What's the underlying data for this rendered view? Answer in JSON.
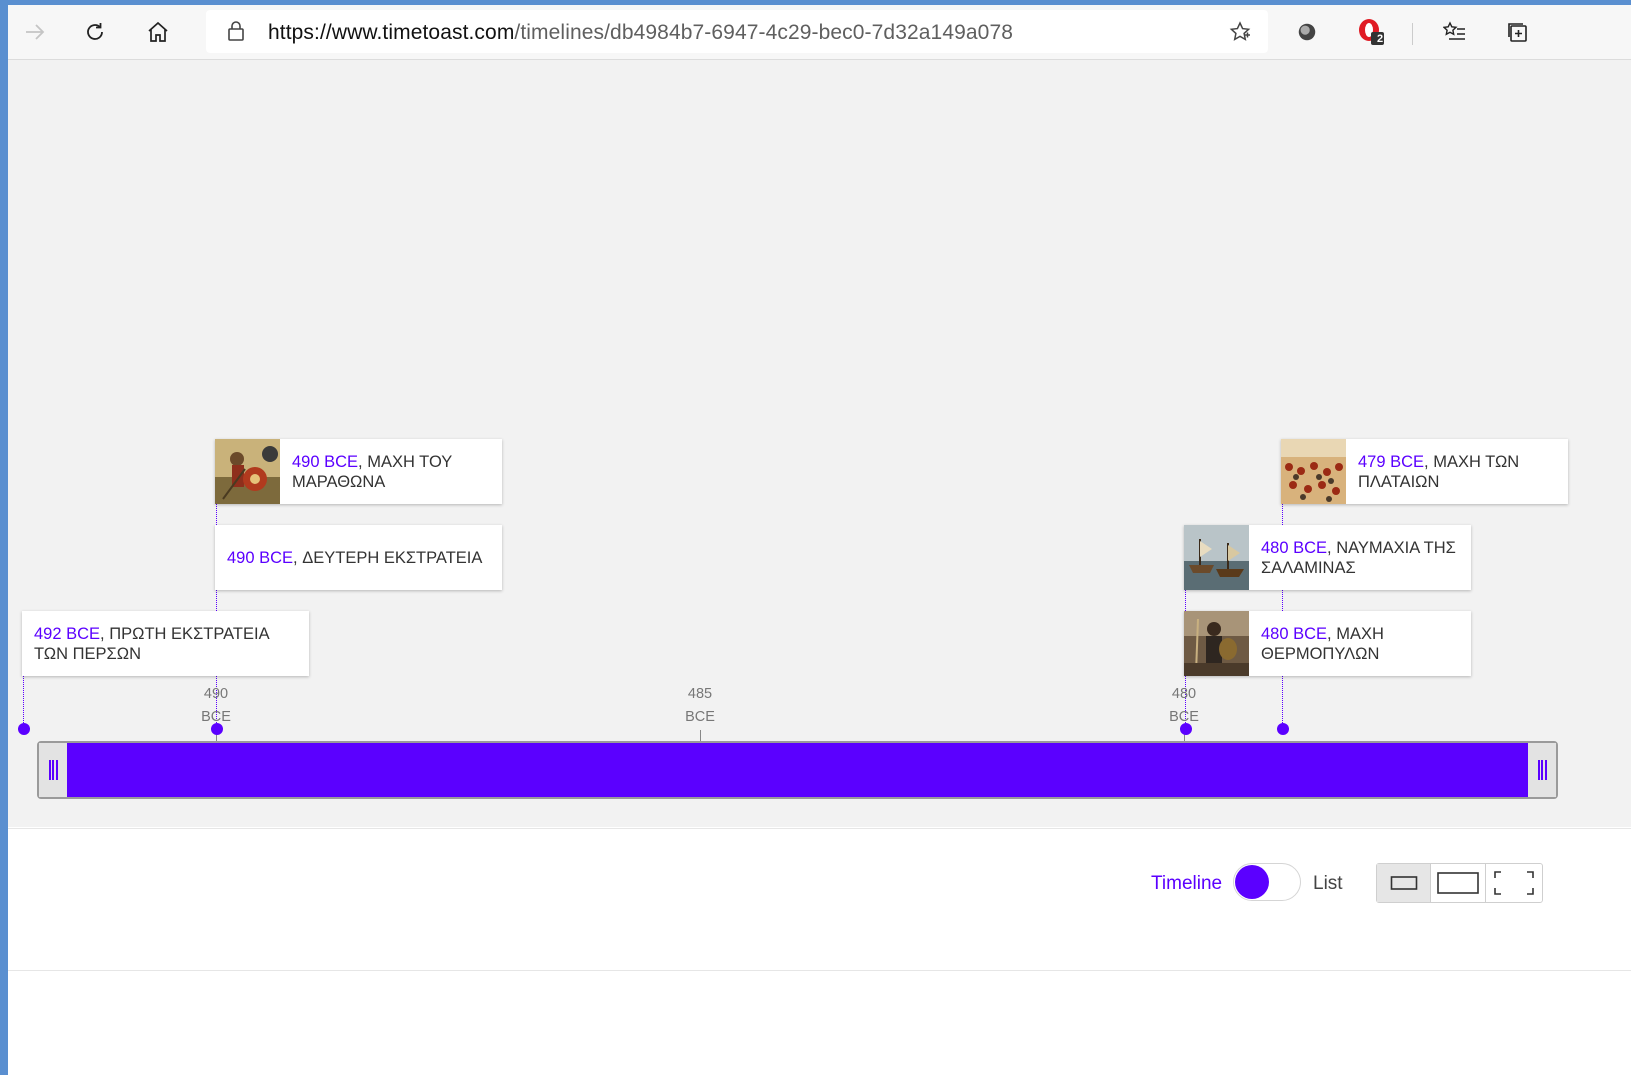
{
  "browser": {
    "url_host": "https://www.timetoast.com",
    "url_path": "/timelines/db4984b7-6947-4c29-bec0-7d32a149a078",
    "extension_badge": "2"
  },
  "timeline": {
    "events": [
      {
        "year": "490 BCE",
        "sep": ", ",
        "title": "ΜΑΧΗ ΤΟΥ ΜΑΡΑΘΩΝΑ"
      },
      {
        "year": "490 BCE",
        "sep": ", ",
        "title": "ΔΕΥΤΕΡΗ ΕΚΣΤΡΑΤΕΙΑ"
      },
      {
        "year": "492 BCE",
        "sep": ", ",
        "title": "ΠΡΩΤΗ ΕΚΣΤΡΑΤΕΙΑ ΤΩΝ ΠΕΡΣΩΝ"
      },
      {
        "year": "479 BCE",
        "sep": ", ",
        "title": "ΜΑΧΗ ΤΩΝ ΠΛΑΤΑΙΩΝ"
      },
      {
        "year": "480 BCE",
        "sep": ", ",
        "title": "ΝΑΥΜΑΧΙΑ ΤΗΣ ΣΑΛΑΜΙΝΑΣ"
      },
      {
        "year": "480 BCE",
        "sep": ", ",
        "title": "ΜΑΧΗ ΘΕΡΜΟΠΥΛΩΝ"
      }
    ],
    "axis_ticks": [
      {
        "num": "490",
        "era": "BCE"
      },
      {
        "num": "485",
        "era": "BCE"
      },
      {
        "num": "480",
        "era": "BCE"
      }
    ]
  },
  "view_controls": {
    "timeline_label": "Timeline",
    "list_label": "List",
    "toggle_state": "timeline"
  },
  "colors": {
    "accent": "#5b00ff",
    "canvas_bg": "#f2f2f2"
  }
}
